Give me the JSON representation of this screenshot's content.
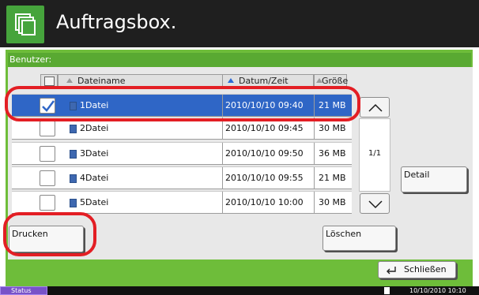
{
  "header": {
    "title": "Auftragsbox.",
    "icon": "document-box-icon"
  },
  "user": {
    "label": "Benutzer:"
  },
  "table": {
    "headers": {
      "name": "Dateiname",
      "date": "Datum/Zeit",
      "size": "Größe"
    },
    "rows": [
      {
        "name": "1Datei",
        "date": "2010/10/10 09:40",
        "size": "21 MB",
        "checked": true,
        "selected": true
      },
      {
        "name": "2Datei",
        "date": "2010/10/10 09:45",
        "size": "30 MB",
        "checked": false,
        "selected": false
      },
      {
        "name": "3Datei",
        "date": "2010/10/10 09:50",
        "size": "36 MB",
        "checked": false,
        "selected": false
      },
      {
        "name": "4Datei",
        "date": "2010/10/10 09:55",
        "size": "21 MB",
        "checked": false,
        "selected": false
      },
      {
        "name": "5Datei",
        "date": "2010/10/10 10:00",
        "size": "30 MB",
        "checked": false,
        "selected": false
      }
    ]
  },
  "pagination": {
    "indicator": "1/1"
  },
  "buttons": {
    "detail": "Detail",
    "print": "Drucken",
    "delete": "Löschen",
    "close": "Schließen"
  },
  "status": {
    "label": "Status",
    "datetime": "10/10/2010 10:10"
  },
  "colors": {
    "header_bg": "#1f1f1f",
    "accent_green": "#6ebd3a",
    "selected_row": "#2f66c6",
    "highlight_red": "#e31e24",
    "status_purple": "#7752c8"
  }
}
